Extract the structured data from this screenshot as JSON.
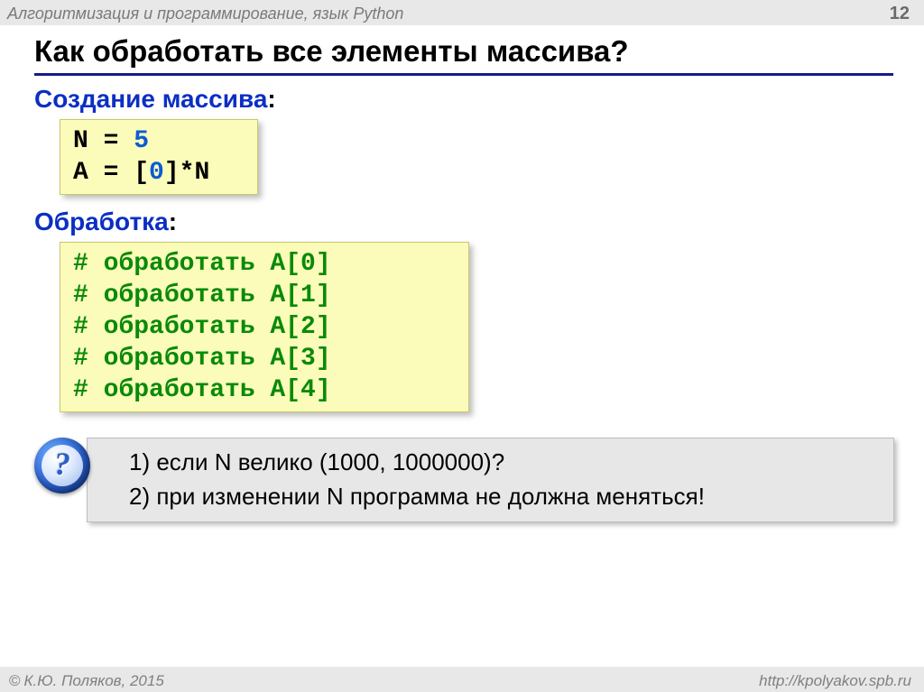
{
  "header": {
    "course": "Алгоритмизация и программирование, язык Python",
    "page": "12"
  },
  "title": "Как обработать все элементы массива?",
  "sections": {
    "create_label": "Создание массива",
    "process_label": "Обработка"
  },
  "code1": {
    "l1a": "N",
    "l1b": " = ",
    "l1c": "5",
    "l2a": "A",
    "l2b": " = [",
    "l2c": "0",
    "l2d": "]*N"
  },
  "code2": {
    "lines": [
      "# обработать A[0]",
      "# обработать A[1]",
      "# обработать A[2]",
      "# обработать A[3]",
      "# обработать A[4]"
    ]
  },
  "question": {
    "mark": "?",
    "item1": "1) если N велико (1000, 1000000)?",
    "item2": "2) при изменении N программа не должна меняться!"
  },
  "footer": {
    "copyright": "К.Ю. Поляков, 2015",
    "url": "http://kpolyakov.spb.ru"
  }
}
